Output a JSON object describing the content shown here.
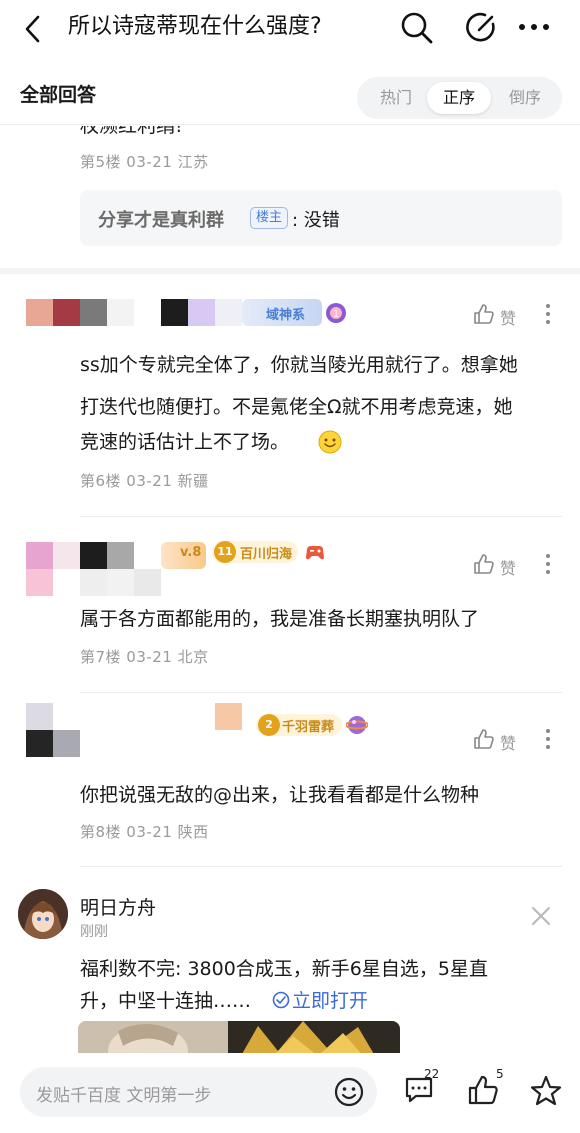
{
  "header": {
    "title": "所以诗寇蒂现在什么强度?"
  },
  "section": {
    "title": "全部回答",
    "sort": [
      "热门",
      "正序",
      "倒序"
    ],
    "active": "正序"
  },
  "post5": {
    "cut_text": "权濒红利绢!",
    "meta": "第5楼   03-21  江苏",
    "reply_user": "分享才是真利群",
    "reply_badge": "楼主",
    "reply_text": ": 没错"
  },
  "post6": {
    "badge": "域神系",
    "like": "赞",
    "lines": [
      "ss加个专就完全体了，你就当陵光用就行了。想拿她",
      "打迭代也随便打。不是氪佬全Ω就不用考虑竞速，她",
      "竞速的话估计上不了场。"
    ],
    "meta": "第6楼   03-21  新疆"
  },
  "post7": {
    "level": "v.8",
    "badge_num": "11",
    "badge": "百川归海",
    "like": "赞",
    "text": "属于各方面都能用的，我是准备长期塞执明队了",
    "meta": "第7楼   03-21  北京"
  },
  "post8": {
    "badge_num": "2",
    "badge": "千羽雷葬",
    "like": "赞",
    "text": "你把说强无敌的@出来，让我看看都是什么物种",
    "meta": "第8楼   03-21  陕西"
  },
  "ad": {
    "name": "明日方舟",
    "time": "刚刚",
    "line1": "福利数不完: 3800合成玉，新手6星自选，5星直",
    "line2": "升，中坚十连抽……",
    "link": "立即打开"
  },
  "bottom": {
    "placeholder": "发贴千百度 文明第一步",
    "comment_count": "22",
    "like_count": "5"
  },
  "colors": {
    "link": "#3a6bd8",
    "gold": "#e3a21b",
    "blue_badge": "#4a7fd4",
    "divider": "#ececec"
  }
}
